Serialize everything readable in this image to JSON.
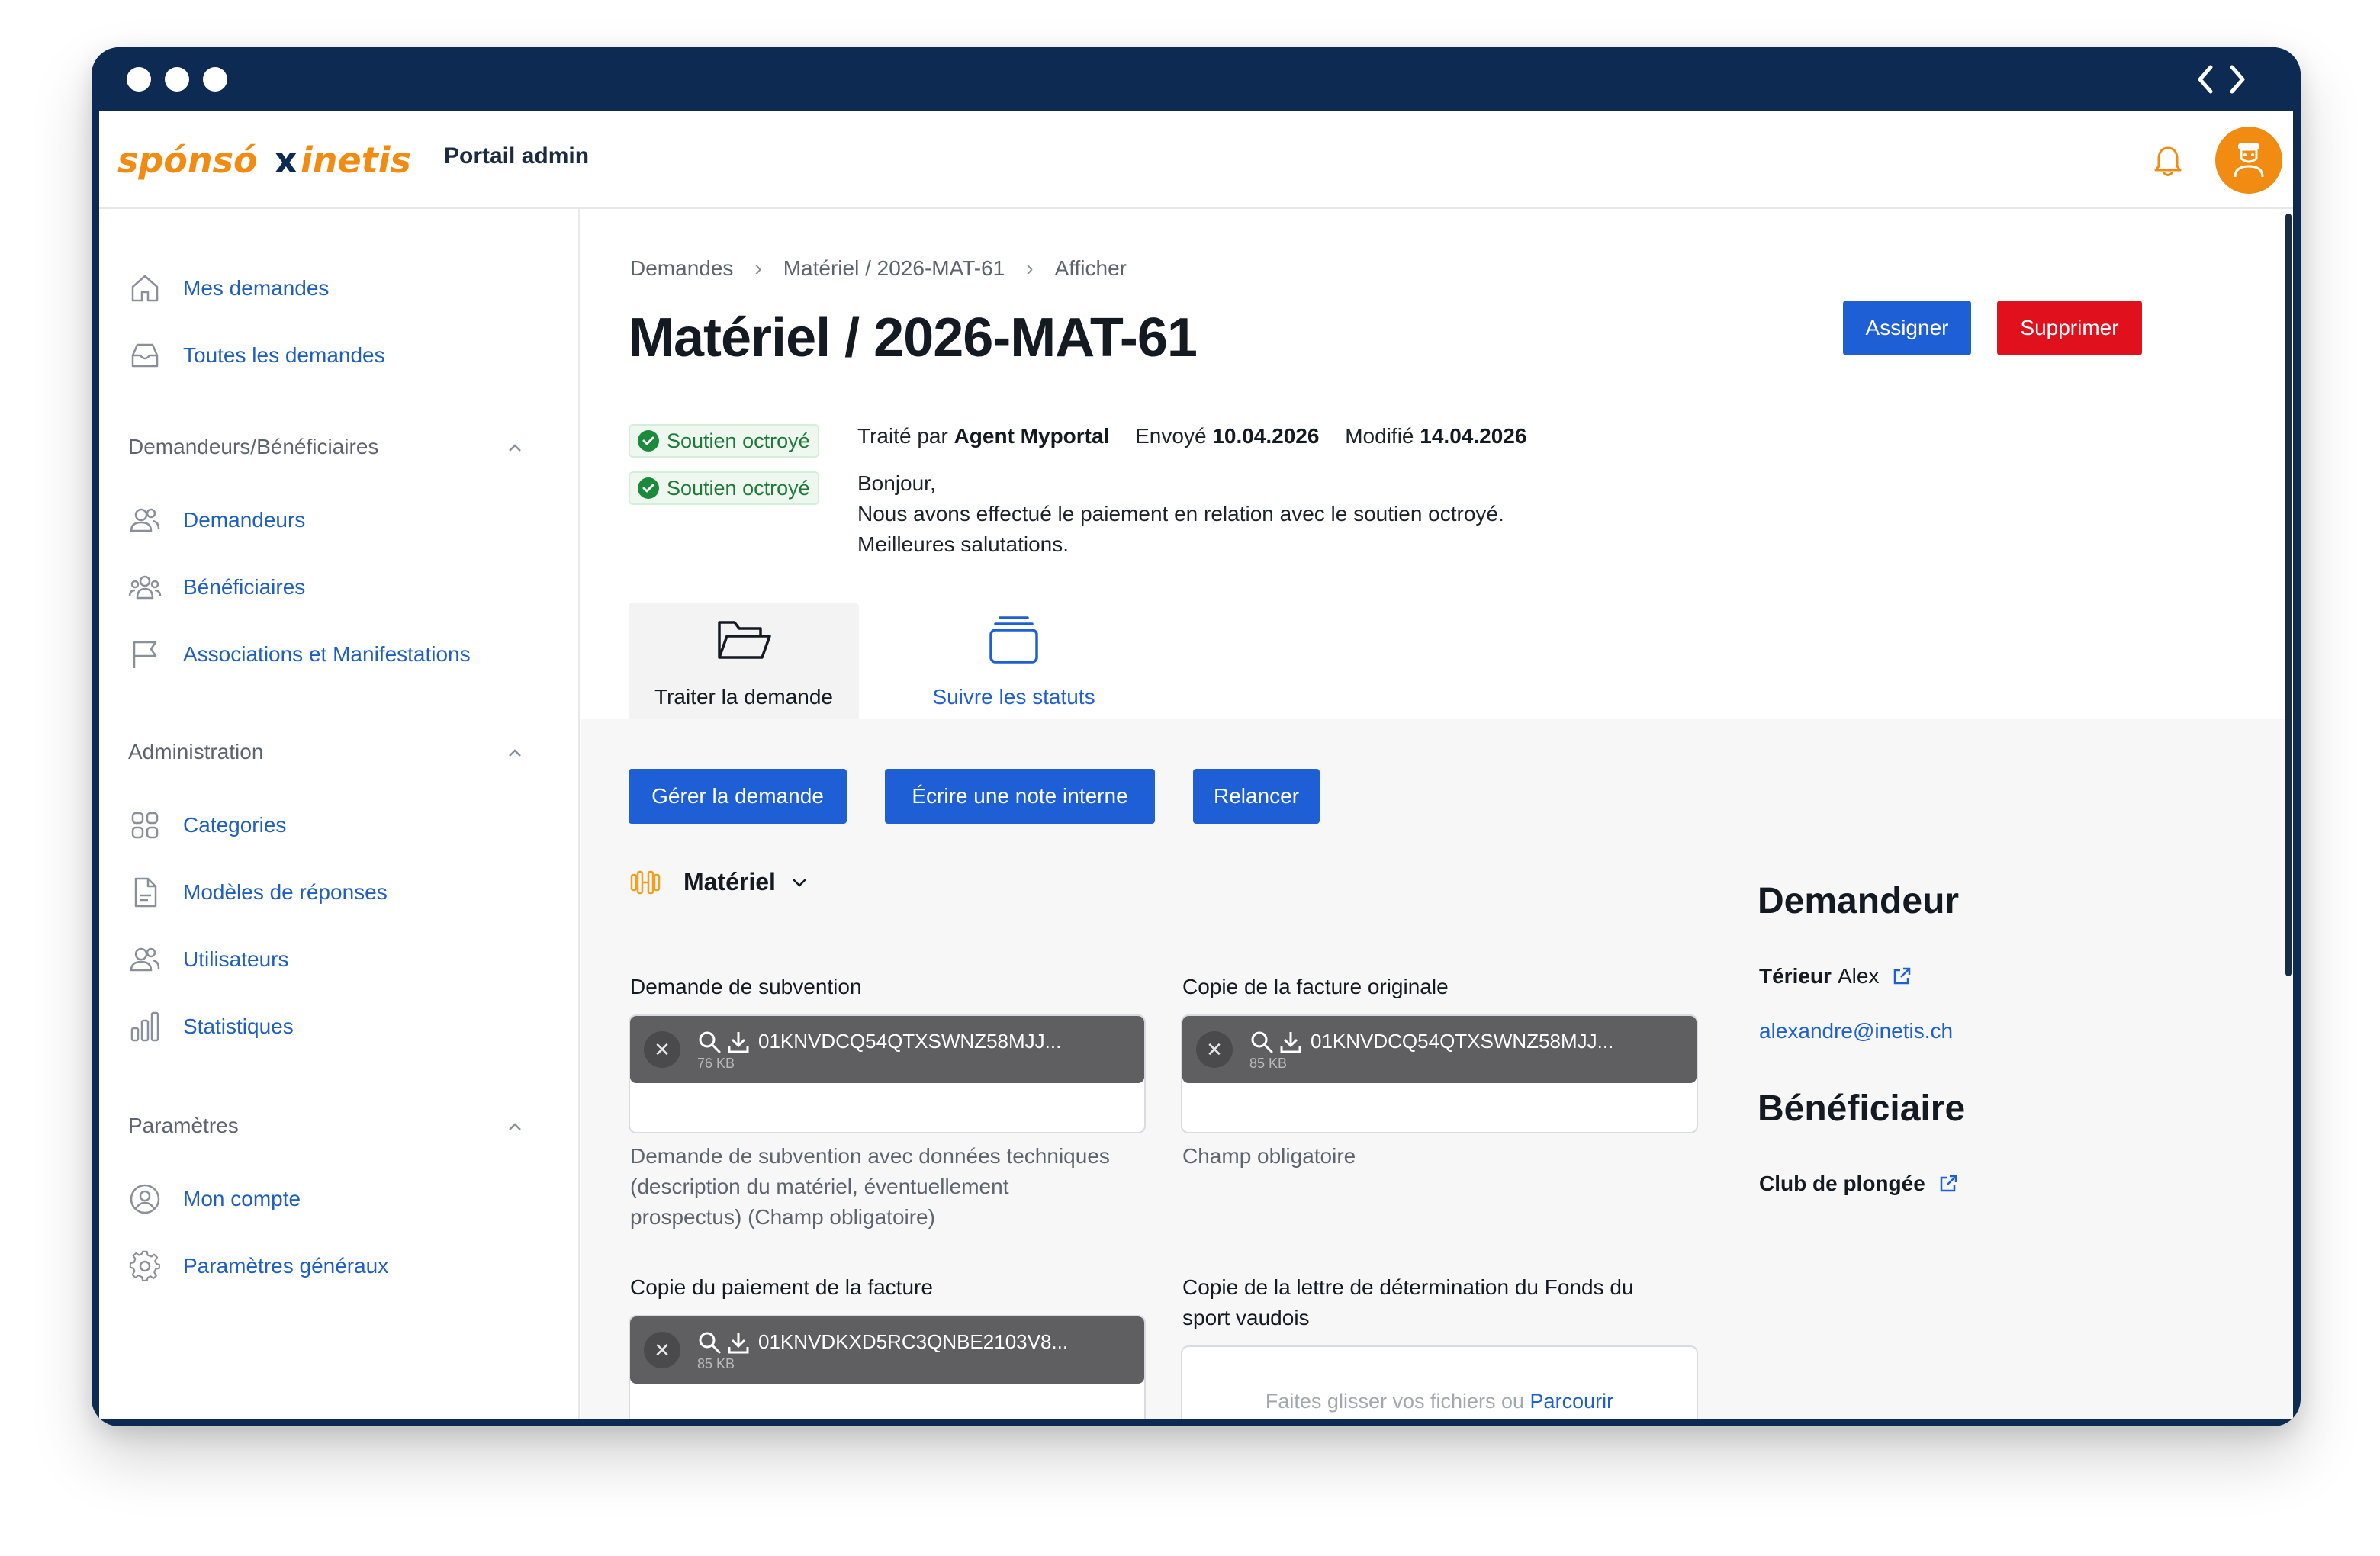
{
  "colors": {
    "frame": "#0d2a52",
    "accent_blue": "#1f5fd6",
    "danger_red": "#e0101c",
    "brand_orange": "#f28b12",
    "success_green": "#1c8a3d"
  },
  "header": {
    "portal_title": "Portail admin",
    "logo_text": "sponso x inetis"
  },
  "sidebar": {
    "items_top": [
      {
        "label": "Mes demandes",
        "icon": "home-icon"
      },
      {
        "label": "Toutes les demandes",
        "icon": "inbox-icon"
      }
    ],
    "sections": [
      {
        "title": "Demandeurs/Bénéficiaires",
        "items": [
          {
            "label": "Demandeurs",
            "icon": "users-icon"
          },
          {
            "label": "Bénéficiaires",
            "icon": "group-icon"
          },
          {
            "label": "Associations et Manifestations",
            "icon": "flag-icon"
          }
        ]
      },
      {
        "title": "Administration",
        "items": [
          {
            "label": "Categories",
            "icon": "grid-icon"
          },
          {
            "label": "Modèles de réponses",
            "icon": "document-icon"
          },
          {
            "label": "Utilisateurs",
            "icon": "users-icon"
          },
          {
            "label": "Statistiques",
            "icon": "bar-chart-icon"
          }
        ]
      },
      {
        "title": "Paramètres",
        "items": [
          {
            "label": "Mon compte",
            "icon": "user-circle-icon"
          },
          {
            "label": "Paramètres généraux",
            "icon": "gear-icon"
          }
        ]
      }
    ]
  },
  "breadcrumb": [
    "Demandes",
    "Matériel / 2026-MAT-61",
    "Afficher"
  ],
  "page_title": "Matériel / 2026-MAT-61",
  "actions": {
    "assign": "Assigner",
    "delete": "Supprimer"
  },
  "status": {
    "badge": "Soutien octroyé",
    "treated_prefix": "Traité par",
    "treated_by": "Agent Myportal",
    "sent_prefix": "Envoyé",
    "sent_date": "10.04.2026",
    "modified_prefix": "Modifié",
    "modified_date": "14.04.2026",
    "message_lines": [
      "Bonjour,",
      "Nous avons effectué le paiement en relation avec le soutien octroyé.",
      "Meilleures salutations."
    ]
  },
  "tabs": [
    {
      "label": "Traiter la demande",
      "icon": "folder-open-icon",
      "active": true
    },
    {
      "label": "Suivre les statuts",
      "icon": "stack-icon",
      "active": false
    }
  ],
  "request_actions": {
    "manage": "Gérer la demande",
    "note": "Écrire une note interne",
    "remind": "Relancer"
  },
  "category": {
    "label": "Matériel",
    "icon": "dumbbell-icon"
  },
  "fields": [
    {
      "label": "Demande de subvention",
      "file_name": "01KNVDCQ54QTXSWNZ58MJJ...",
      "file_size": "76 KB",
      "help": [
        "Demande de subvention avec données techniques",
        "(description du matériel, éventuellement",
        "prospectus) (Champ obligatoire)"
      ]
    },
    {
      "label": "Copie de la facture originale",
      "file_name": "01KNVDCQ54QTXSWNZ58MJJ...",
      "file_size": "85 KB",
      "help": [
        "Champ obligatoire"
      ]
    },
    {
      "label": "Copie du paiement de la facture",
      "file_name": "01KNVDKXD5RC3QNBE2103V8...",
      "file_size": "85 KB"
    },
    {
      "label_lines": [
        "Copie de la lettre de détermination du Fonds du",
        "sport vaudois"
      ],
      "drop_text": "Faites glisser vos fichiers ou",
      "browse": "Parcourir"
    }
  ],
  "requester": {
    "heading": "Demandeur",
    "last_name": "Térieur",
    "first_name": "Alex",
    "email": "alexandre@inetis.ch"
  },
  "beneficiary": {
    "heading": "Bénéficiaire",
    "name": "Club de plongée"
  }
}
